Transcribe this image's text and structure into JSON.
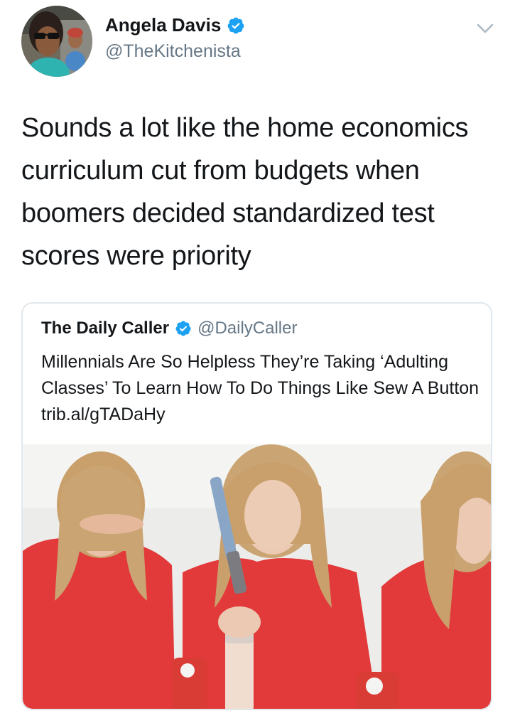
{
  "user": {
    "display_name": "Angela Davis",
    "handle": "@TheKitchenista",
    "verified": true
  },
  "tweet": {
    "text": "Sounds a lot like the home economics curriculum cut from budgets when boomers decided standardized test scores were priority"
  },
  "quoted_tweet": {
    "display_name": "The Daily Caller",
    "handle": "@DailyCaller",
    "verified": true,
    "text": "Millennials Are So Helpless They’re Taking ‘Adulting Classes’ To Learn How To Do Things Like Sew A Button trib.al/gTADaHy"
  },
  "icons": {
    "verified": "verified-badge-icon",
    "menu": "chevron-down-icon"
  },
  "colors": {
    "verified_blue": "#1da1f2",
    "secondary_text": "#657786",
    "card_border": "#e1e8ed",
    "shirt_red": "#e23a3a"
  }
}
